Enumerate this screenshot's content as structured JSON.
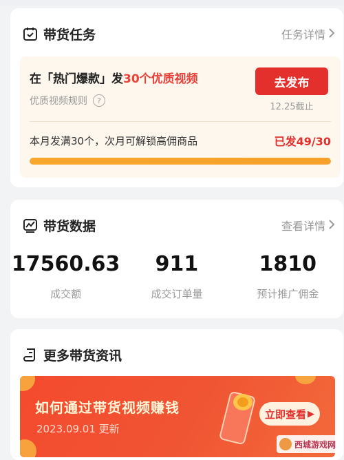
{
  "task_card": {
    "title": "带货任务",
    "link": "任务详情",
    "task_prefix": "在「热门爆款」发",
    "task_highlight": "30个优质视频",
    "rule_text": "优质视频规则",
    "help_glyph": "?",
    "publish_button": "去发布",
    "deadline": "12.25截止",
    "progress_text": "本月发满30个，次月可解锁高佣商品",
    "progress_count": "已发49/30",
    "progress_fraction": 1.0
  },
  "data_card": {
    "title": "带货数据",
    "link": "查看详情",
    "stats": [
      {
        "value": "17560.63",
        "label": "成交额"
      },
      {
        "value": "911",
        "label": "成交订单量"
      },
      {
        "value": "1810",
        "label": "预计推广佣金"
      }
    ]
  },
  "info_card": {
    "title": "更多带货资讯",
    "banner": {
      "title": "如何通过带货视频赚钱",
      "date": "2023.09.01 更新",
      "button": "立即查看"
    }
  },
  "watermark": {
    "text": "西城游戏网"
  },
  "icons": {
    "task": "calendar-check-icon",
    "data": "chart-line-icon",
    "info": "scroll-icon",
    "chevron": "chevron-right-icon"
  },
  "colors": {
    "accent_red": "#e3302d",
    "progress": "#f8a72b",
    "task_bg": "#fdf7ee"
  }
}
